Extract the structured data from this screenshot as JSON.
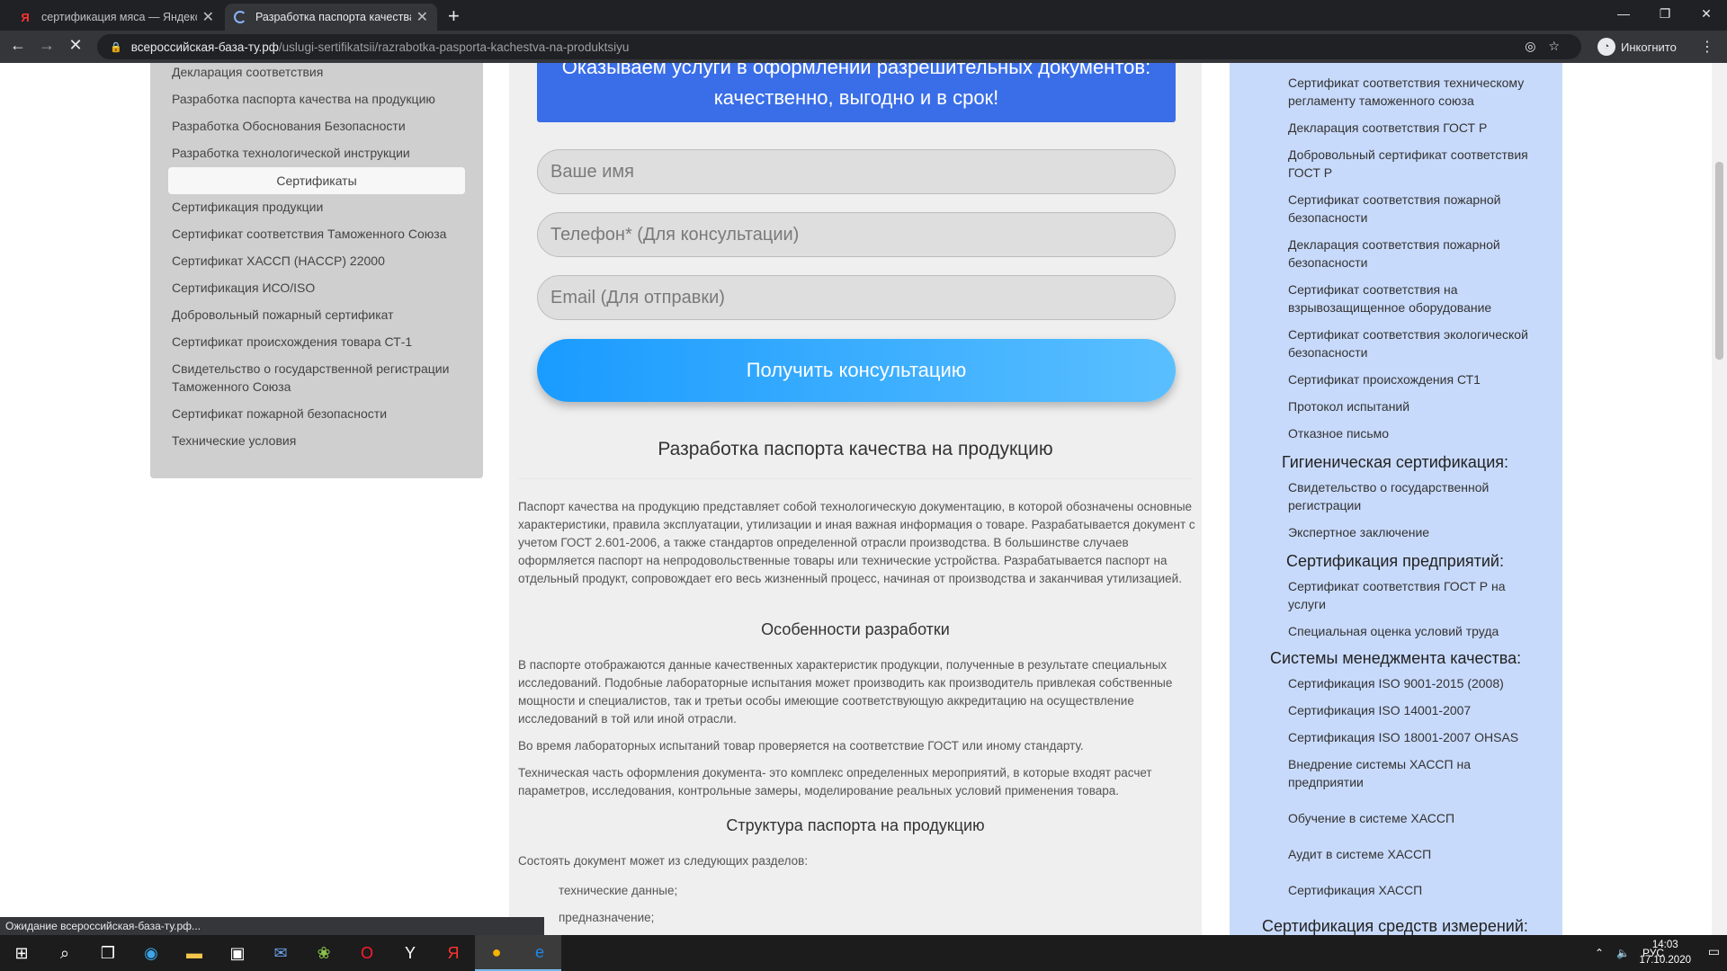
{
  "browser": {
    "tabs": [
      {
        "title": "сертификация мяса — Яндекс: н",
        "favicon": "yandex-icon",
        "active": false
      },
      {
        "title": "Разработка паспорта качества н",
        "favicon": "loading-spinner-icon",
        "active": true
      }
    ],
    "url_host": "всероссийская-база-ту.рф",
    "url_path": "/uslugi-sertifikatsii/razrabotka-pasporta-kachestva-na-produktsiyu",
    "profile_label": "Инкогнито",
    "status_text": "Ожидание всероссийская-база-ту.рф..."
  },
  "left_sidebar": {
    "items_top": [
      "Декларация соответствия",
      "Разработка паспорта качества на продукцию",
      "Разработка Обоснования Безопасности",
      "Разработка технологической инструкции"
    ],
    "section_header": "Сертификаты",
    "items": [
      "Сертификация продукции",
      "Сертификат соответствия Таможенного Союза",
      "Сертификат ХАССП (HACCP) 22000",
      "Сертификация ИСО/ISO",
      "Добровольный пожарный сертификат",
      "Сертификат происхождения товара СТ-1",
      "Свидетельство о государственной регистрации Таможенного Союза",
      "Сертификат пожарной безопасности",
      "Технические условия"
    ]
  },
  "form": {
    "banner": "Оказываем услуги в оформлении разрешительных документов: качественно, выгодно и в срок!",
    "name_placeholder": "Ваше имя",
    "phone_placeholder": "Телефон* (Для консультации)",
    "email_placeholder": "Email (Для отправки)",
    "submit_label": "Получить консультацию"
  },
  "article": {
    "title": "Разработка паспорта качества на продукцию",
    "intro": "Паспорт качества на продукцию представляет собой технологическую документацию, в которой обозначены основные характеристики, правила эксплуатации, утилизации и иная важная информация о товаре. Разрабатывается документ с учетом ГОСТ 2.601-2006, а также стандартов определенной отрасли производства. В большинстве случаев оформляется паспорт на непродовольственные товары или технические устройства. Разрабатывается паспорт на отдельный продукт, сопровождает его весь жизненный процесс, начиная от производства и заканчивая утилизацией.",
    "h2_features": "Особенности разработки",
    "features_p1": "В паспорте отображаются данные качественных характеристик продукции, полученные в результате специальных исследований. Подобные лабораторные испытания может производить как производитель привлекая собственные мощности и специалистов, так и третьи особы имеющие соответствующую аккредитацию на осуществление исследований в той или иной отрасли.",
    "features_p2": "Во время лабораторных испытаний товар проверяется на соответствие ГОСТ или иному стандарту.",
    "features_p3": "Техническая часть оформления документа- это комплекс определенных мероприятий, в которые входят расчет параметров, исследования, контрольные замеры, моделирование реальных условий применения товара.",
    "h2_structure": "Структура паспорта на продукцию",
    "structure_intro": "Состоять документ может из следующих разделов:",
    "structure_items": [
      "технические данные;",
      "предназначение;"
    ]
  },
  "right_sidebar": {
    "items_a": [
      "Сертификат соответствия техническому регламенту таможенного союза",
      "Декларация соответствия ГОСТ Р",
      "Добровольный сертификат соответствия ГОСТ Р",
      "Сертификат соответствия пожарной безопасности",
      "Декларация соответствия пожарной безопасности",
      "Сертификат соответствия на взрывозащищенное оборудование",
      "Сертификат соответствия экологической безопасности",
      "Сертификат происхождения СТ1",
      "Протокол испытаний",
      "Отказное письмо"
    ],
    "sec_hygiene": "Гигиеническая сертификация:",
    "items_hygiene": [
      "Свидетельство о государственной регистрации",
      "Экспертное заключение"
    ],
    "sec_enterprise": "Сертификация предприятий:",
    "items_enterprise": [
      "Сертификат соответствия ГОСТ Р на услуги",
      "Специальная оценка условий труда"
    ],
    "sec_quality": "Системы менеджмента качества:",
    "items_quality": [
      "Сертификация  ISO 9001-2015 (2008)",
      "Сертификация ISO 14001-2007",
      "Сертификация ISO 18001-2007 OHSAS",
      "Внедрение системы ХАССП на предприятии",
      "Обучение в системе ХАССП",
      "Аудит в системе ХАССП",
      "Сертификация ХАССП"
    ],
    "sec_measure": "Сертификация средств измерений:"
  },
  "taskbar": {
    "lang": "РУС",
    "time": "14:03",
    "date": "17.10.2020"
  }
}
